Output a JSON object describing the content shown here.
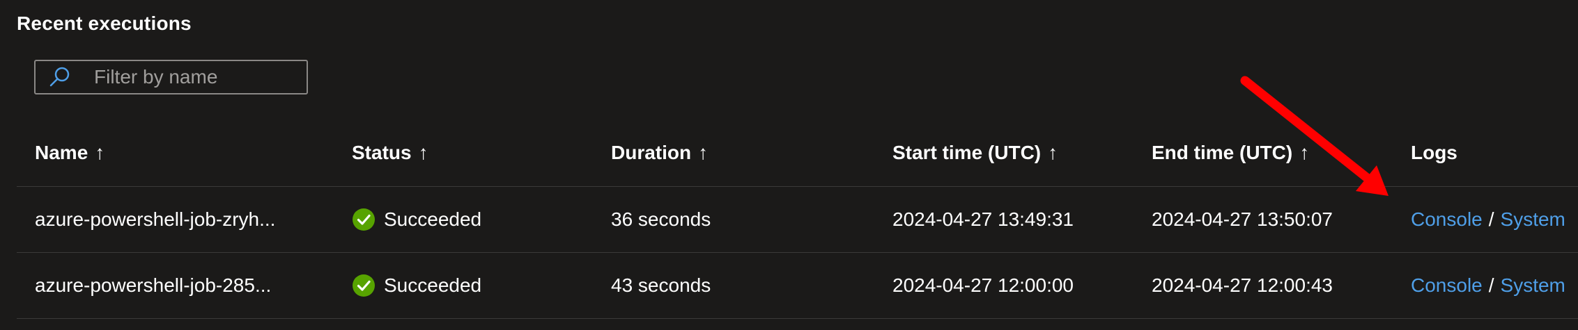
{
  "section": {
    "title": "Recent executions"
  },
  "filter": {
    "placeholder": "Filter by name",
    "value": "",
    "icon": "search-icon"
  },
  "columns": [
    {
      "label": "Name",
      "sort": "↑"
    },
    {
      "label": "Status",
      "sort": "↑"
    },
    {
      "label": "Duration",
      "sort": "↑"
    },
    {
      "label": "Start time (UTC)",
      "sort": "↑"
    },
    {
      "label": "End time (UTC)",
      "sort": "↑"
    },
    {
      "label": "Logs"
    }
  ],
  "rows": [
    {
      "name": "azure-powershell-job-zryh...",
      "status": "Succeeded",
      "duration": "36 seconds",
      "start": "2024-04-27 13:49:31",
      "end": "2024-04-27 13:50:07",
      "logs": {
        "console": "Console",
        "separator": "/",
        "system": "System"
      }
    },
    {
      "name": "azure-powershell-job-285...",
      "status": "Succeeded",
      "duration": "43 seconds",
      "start": "2024-04-27 12:00:00",
      "end": "2024-04-27 12:00:43",
      "logs": {
        "console": "Console",
        "separator": "/",
        "system": "System"
      }
    }
  ],
  "colors": {
    "background": "#1b1a19",
    "link": "#4f9fe8",
    "success": "#57a300",
    "annotation_arrow": "#ff0000"
  }
}
